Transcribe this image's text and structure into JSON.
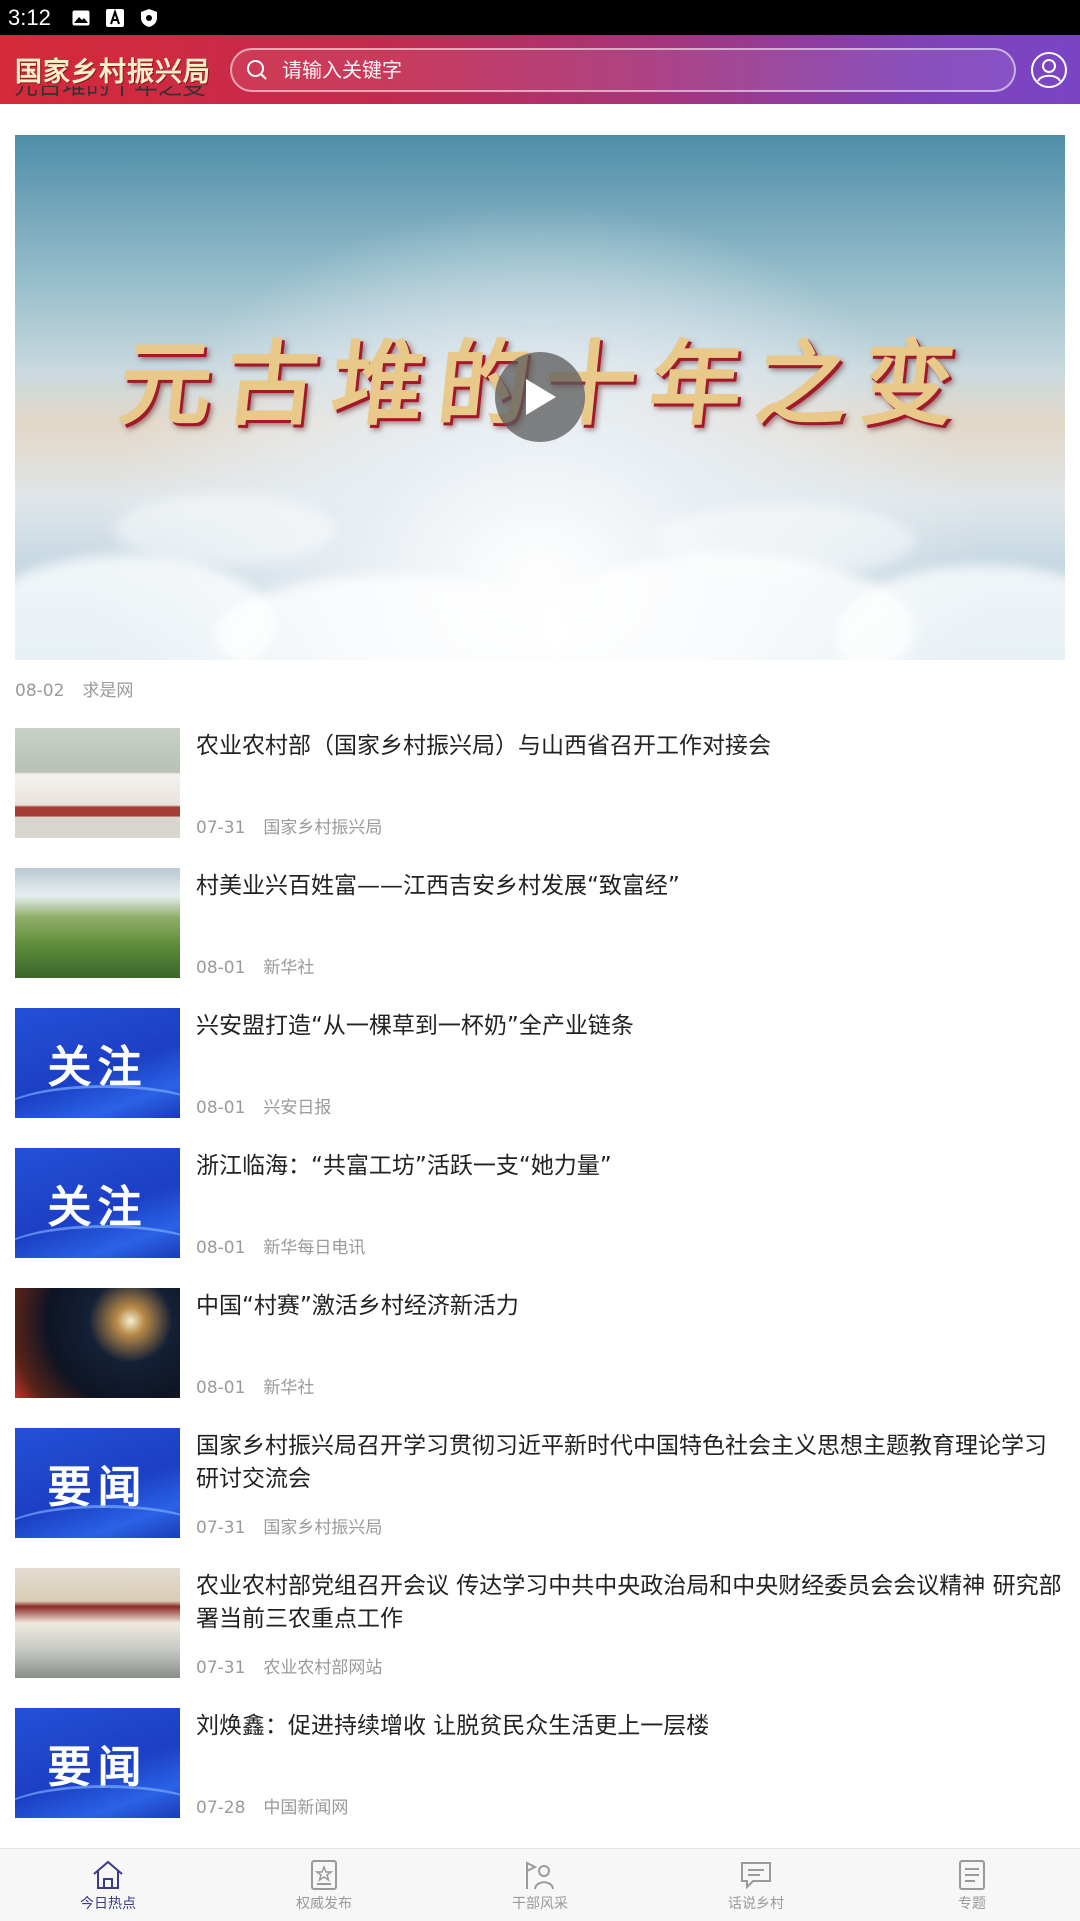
{
  "status_bar": {
    "time": "3:12"
  },
  "header": {
    "logo_text": "国家乡村振兴局",
    "search_placeholder": "请输入关键字"
  },
  "featured": {
    "cut_title": "元古堆的十年之变",
    "video_overlay_text": "元古堆的十年之变",
    "date": "08-02",
    "source": "求是网"
  },
  "news": [
    {
      "title": "农业农村部（国家乡村振兴局）与山西省召开工作对接会",
      "date": "07-31",
      "source": "国家乡村振兴局",
      "thumb": "photo-meeting",
      "tag": ""
    },
    {
      "title": "村美业兴百姓富——江西吉安乡村发展“致富经”",
      "date": "08-01",
      "source": "新华社",
      "thumb": "photo-hills",
      "tag": ""
    },
    {
      "title": "兴安盟打造“从一棵草到一杯奶”全产业链条",
      "date": "08-01",
      "source": "兴安日报",
      "thumb": "tag",
      "tag": "关注"
    },
    {
      "title": "浙江临海：“共富工坊”活跃一支“她力量”",
      "date": "08-01",
      "source": "新华每日电讯",
      "thumb": "tag",
      "tag": "关注"
    },
    {
      "title": "中国“村赛”激活乡村经济新活力",
      "date": "08-01",
      "source": "新华社",
      "thumb": "photo-fireworks",
      "tag": ""
    },
    {
      "title": "国家乡村振兴局召开学习贯彻习近平新时代中国特色社会主义思想主题教育理论学习研讨交流会",
      "date": "07-31",
      "source": "国家乡村振兴局",
      "thumb": "tag",
      "tag": "要闻"
    },
    {
      "title": "农业农村部党组召开会议 传达学习中共中央政治局和中央财经委员会会议精神 研究部署当前三农重点工作",
      "date": "07-31",
      "source": "农业农村部网站",
      "thumb": "photo-conference",
      "tag": ""
    },
    {
      "title": "刘焕鑫：促进持续增收 让脱贫民众生活更上一层楼",
      "date": "07-28",
      "source": "中国新闻网",
      "thumb": "tag",
      "tag": "要闻"
    }
  ],
  "bottom_nav": [
    {
      "label": "今日热点",
      "icon": "home-icon",
      "active": true
    },
    {
      "label": "权威发布",
      "icon": "document-star-icon",
      "active": false
    },
    {
      "label": "干部风采",
      "icon": "person-flag-icon",
      "active": false
    },
    {
      "label": "话说乡村",
      "icon": "chat-icon",
      "active": false
    },
    {
      "label": "专题",
      "icon": "list-doc-icon",
      "active": false
    }
  ],
  "colors": {
    "header_start": "#d42a3a",
    "header_end": "#7a45c5",
    "tag_blue": "#1c3fc4",
    "nav_active": "#3a3a8c"
  }
}
